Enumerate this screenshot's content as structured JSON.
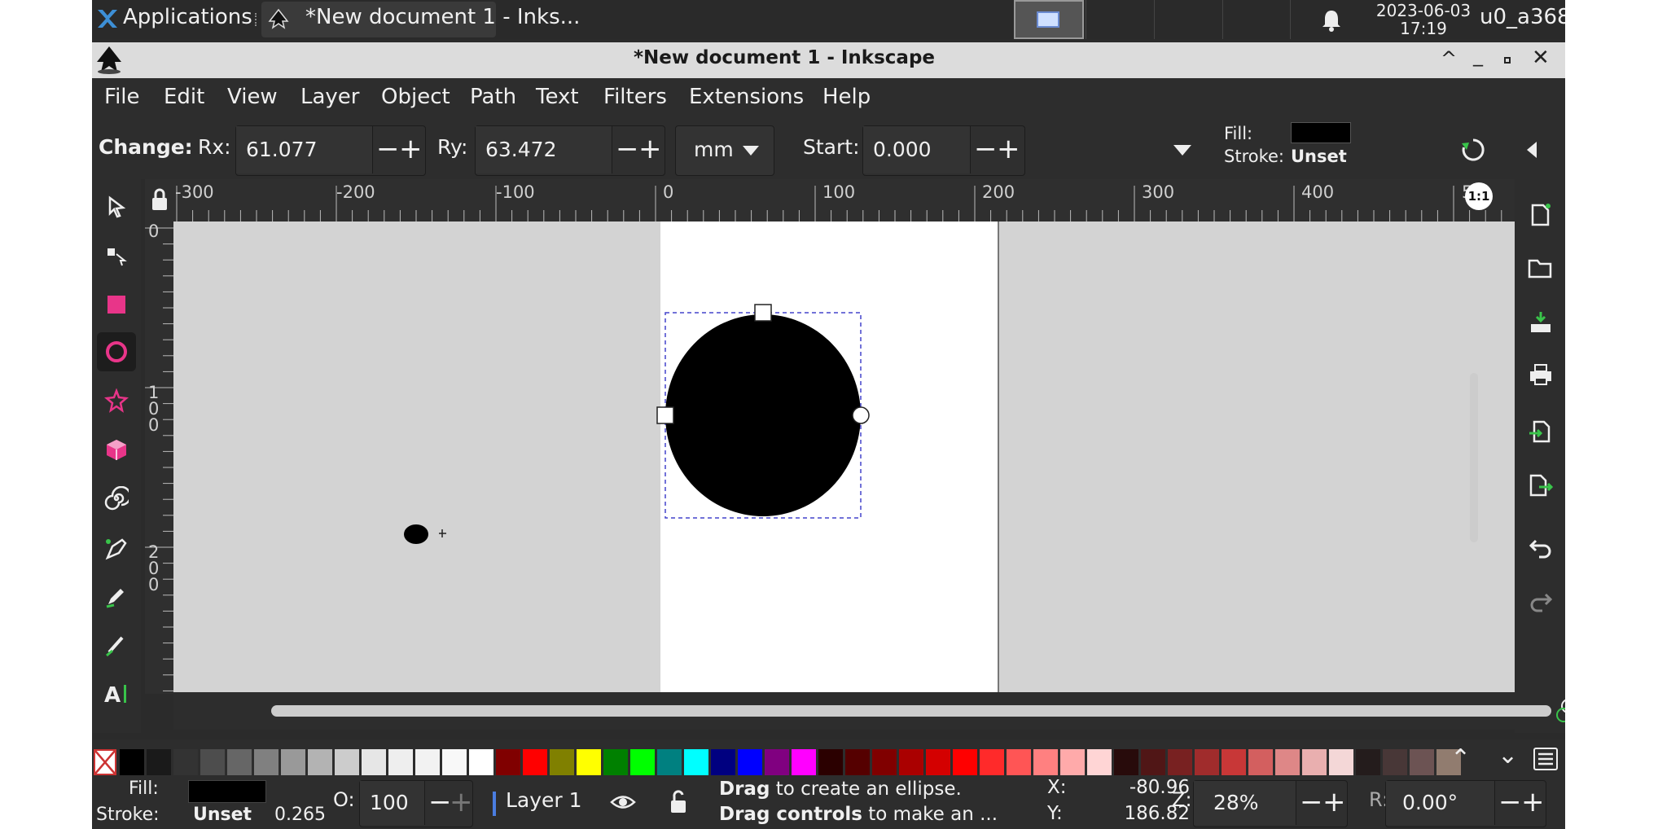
{
  "taskbar": {
    "applications_label": "Applications",
    "window_task_label": "*New document 1 - Inks...",
    "date": "2023-06-03",
    "time": "17:19",
    "user": "u0_a368"
  },
  "titlebar": {
    "title": "*New document 1 - Inkscape"
  },
  "menu": [
    "File",
    "Edit",
    "View",
    "Layer",
    "Object",
    "Path",
    "Text",
    "Filters",
    "Extensions",
    "Help"
  ],
  "tool_controls": {
    "change_label": "Change:",
    "rx_label": "Rx:",
    "rx_value": "61.077",
    "ry_label": "Ry:",
    "ry_value": "63.472",
    "unit": "mm",
    "start_label": "Start:",
    "start_value": "0.000",
    "fill_label": "Fill:",
    "stroke_label": "Stroke:",
    "stroke_value": "Unset"
  },
  "ruler": {
    "h_labels": [
      "-300",
      "-200",
      "-100",
      "0",
      "100",
      "200",
      "300",
      "400",
      "5"
    ],
    "v_labels": [
      "0",
      "1",
      "0",
      "0",
      "2",
      "0",
      "0"
    ],
    "zoom_button": "1:1"
  },
  "palette_colors": [
    "#000000",
    "#1a1a1a",
    "#333333",
    "#4d4d4d",
    "#666666",
    "#808080",
    "#999999",
    "#b3b3b3",
    "#cccccc",
    "#e6e6e6",
    "#eeeeee",
    "#f2f2f2",
    "#f8f8f8",
    "#ffffff",
    "#800000",
    "#ff0000",
    "#808000",
    "#ffff00",
    "#008000",
    "#00ff00",
    "#008080",
    "#00ffff",
    "#000080",
    "#0000ff",
    "#800080",
    "#ff00ff",
    "#2b0000",
    "#550000",
    "#800000",
    "#aa0000",
    "#d40000",
    "#ff0000",
    "#ff2a2a",
    "#ff5555",
    "#ff8080",
    "#ffaaaa",
    "#ffd5d5",
    "#280b0b",
    "#501616",
    "#782121",
    "#a02c2c",
    "#c83737",
    "#d35f5f",
    "#de8787",
    "#e9afaf",
    "#f4d7d7",
    "#241c1c",
    "#483737",
    "#6c5353",
    "#917c6f"
  ],
  "status": {
    "fill_label": "Fill:",
    "stroke_label": "Stroke:",
    "stroke_value": "Unset",
    "stroke_width": "0.265",
    "opacity_label": "O:",
    "opacity_value": "100",
    "layer_name": "Layer 1",
    "message_line1_bold": "Drag",
    "message_line1": " to create an ellipse.",
    "message_line2_bold": "Drag controls",
    "message_line2": " to make an ...",
    "x_label": "X:",
    "x_value": "-80.96",
    "y_label": "Y:",
    "y_value": "186.82",
    "zoom_label": "Z:",
    "zoom_value": "28%",
    "rotate_label": "R:",
    "rotate_value": "0.00°"
  },
  "colors": {
    "accent": "#d32f70",
    "ui_dark": "#2d2d2d",
    "canvas": "#d3d3d3",
    "selection": "#4444cc"
  }
}
